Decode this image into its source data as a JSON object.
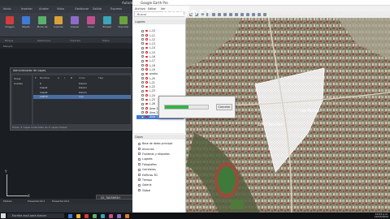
{
  "cad": {
    "title": "Autodesk",
    "tabs": [
      "Inicio",
      "Insertar",
      "Anotar",
      "Vista",
      "Gestionar",
      "Salida",
      "Express"
    ],
    "ribbon_buttons": [
      {
        "label": "Imagen",
        "color": "#d33c3c"
      },
      {
        "label": "Objeto",
        "color": "#3f7ad6"
      },
      {
        "label": "Modo de",
        "color": "#5bb06a"
      },
      {
        "label": "Insertar",
        "color": "#d8a23a"
      },
      {
        "label": "Anexar",
        "color": "#8d6cc7"
      },
      {
        "label": "Crear",
        "color": "#c24f8e"
      },
      {
        "label": "Enlazar",
        "color": "#3aa4b8"
      },
      {
        "label": "Importar",
        "color": "#6aa33d"
      }
    ],
    "panel_labels": [
      "Bloque",
      "Referencia",
      "Importar",
      "Datos"
    ],
    "file_tab": "Dibujo1",
    "layer_dialog": {
      "title": "Administrador de capas",
      "tree": [
        "Todas",
        "Usadas"
      ],
      "headers": [
        "E",
        "Nombre",
        "A",
        "I",
        "B",
        "Color",
        "Tipo"
      ],
      "rows": [
        {
          "name": "0",
          "color": "blanco",
          "selected": false
        },
        {
          "name": "Capa1",
          "color": "blanco",
          "selected": false
        },
        {
          "name": "Capa2",
          "color": "blanco",
          "selected": false
        },
        {
          "name": "LIMITE",
          "color": "rojo",
          "selected": true
        }
      ],
      "footer": "Todas: 4 capas mostradas de 4 capas totales"
    },
    "axis_x": "X",
    "axis_y": "Y",
    "model_tabs": [
      "Modelo",
      "Presentación1",
      "Presentación2"
    ],
    "command_line": "CE_TAESRESH"
  },
  "earth": {
    "title": "Google Earth Pro",
    "menu": [
      "Archivo",
      "Editar",
      "Ver"
    ],
    "search_label": "Buscar",
    "places_header": "Lugares",
    "places": [
      {
        "label": "L-10",
        "selected": false
      },
      {
        "label": "L-11",
        "selected": false
      },
      {
        "label": "L-12",
        "selected": false
      },
      {
        "label": "L-13",
        "selected": false
      },
      {
        "label": "L-14",
        "selected": false
      },
      {
        "label": "L-15",
        "selected": false
      },
      {
        "label": "L-16",
        "selected": false
      },
      {
        "label": "L-17",
        "selected": false
      },
      {
        "label": "L-18",
        "selected": false
      },
      {
        "label": "L-19",
        "selected": false
      },
      {
        "label": "predio",
        "selected": false
      },
      {
        "label": "L-20",
        "selected": false
      },
      {
        "label": "L-21",
        "selected": false
      },
      {
        "label": "L-22",
        "selected": false
      },
      {
        "label": "L-23",
        "selected": false
      },
      {
        "label": "L-24",
        "selected": false
      },
      {
        "label": "L-25",
        "selected": false
      },
      {
        "label": "L-26",
        "selected": false
      },
      {
        "label": "Área 1",
        "selected": false
      },
      {
        "label": "Área 2",
        "selected": false
      },
      {
        "label": "Área 3",
        "selected": true
      }
    ],
    "layers_header": "Capas",
    "layers": [
      "Base de datos principal",
      "Anuncios",
      "Fronteras y etiquetas",
      "Lugares",
      "Fotografías",
      "Carreteras",
      "Edificios 3D",
      "Tiempo",
      "Galería",
      "Global"
    ],
    "map_labels": [
      "Las Rosas",
      "Los Claveles"
    ],
    "import_progress": 0.55,
    "cancel_label": "Cancelar"
  },
  "watermark": "ВЯЮФЕТ",
  "taskbar": {
    "search_placeholder": "Escribe aquí para buscar",
    "icons": [
      "#3f7ad6",
      "#e9b43a",
      "#d33c3c",
      "#5bb06a",
      "#3aa4b8",
      "#c24f8e",
      "#8d6cc7",
      "#e07b2f"
    ],
    "clock": "10:24 p.m.",
    "date": "12/03/2020"
  },
  "colors": {
    "accent": "#3d7bd4",
    "progress": "#33b44a"
  }
}
